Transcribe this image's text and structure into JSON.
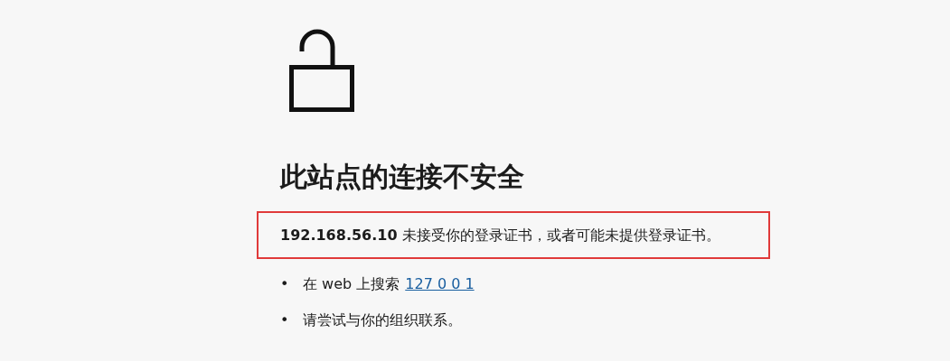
{
  "heading": "此站点的连接不安全",
  "message": "**192.168.56.10** 未接受你的登录证书，或者可能未提供登录证书。",
  "suggestions": [
    {
      "kind": "search",
      "bullet": "•",
      "text": "在 web 上搜索",
      "link": "127 0 0 1"
    },
    {
      "kind": "text",
      "bullet": "•",
      "text": "请尝试与你的组织联系。"
    }
  ]
}
